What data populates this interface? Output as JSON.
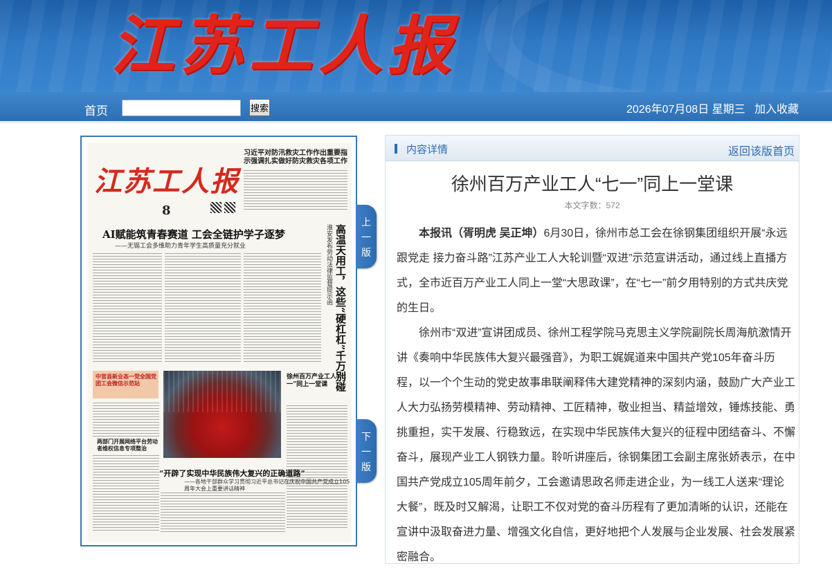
{
  "header": {
    "masthead": "江苏工人报",
    "nav_home": "首页",
    "search_placeholder": "",
    "search_label": "搜索",
    "date": "2026年07月08日 星期三",
    "favorite": "加入收藏"
  },
  "paper_page": {
    "masthead": "江苏工人报",
    "page_no": "8",
    "top_headline": "习近平对防汛救灾工作作出重要指示强调扎实做好防灾救灾各项工作",
    "headline1": "AI赋能筑青春赛道 工会全链护学子逐梦",
    "subheadline1": "——无锡工会多维助力青年学生高质量充分就业",
    "vertical_headline": "高温天用工，这些“硬杠杠”千万别碰",
    "vertical_sub": "淮安发布劳动法律监督提示函",
    "side_headline": "中官县新业态一党全国党团工会微信示范站",
    "side_headline2": "两部门开展网络平台劳动者维权信息专项整治",
    "mid_headline": "徐州百万产业工人“七一”同上一堂课",
    "headline2": "“开辟了实现中华民族伟大复兴的正确道路”",
    "subheadline2": "——各地干部群众学习贯彻习近平总书记在庆祝中国共产党成立105周年大会上重要讲话精神"
  },
  "page_nav": {
    "prev": [
      "上",
      "一",
      "版"
    ],
    "next": [
      "下",
      "一",
      "版"
    ]
  },
  "article": {
    "section_label": "内容详情",
    "back_link": "返回该版首页",
    "title": "徐州百万产业工人“七一”同上一堂课",
    "word_count": "本文字数：572",
    "lead": "本报讯（胥明虎 吴正坤）",
    "para1": "6月30日，徐州市总工会在徐钢集团组织开展“永远跟党走 接力奋斗路”江苏产业工人大轮训暨“双进”示范宣讲活动，通过线上直播方式，全市近百万产业工人同上一堂“大思政课”，在“七一”前夕用特别的方式共庆党的生日。",
    "para2": "徐州市“双进”宣讲团成员、徐州工程学院马克思主义学院副院长周海航激情开讲《奏响中华民族伟大复兴最强音》，为职工娓娓道来中国共产党105年奋斗历程，以一个个生动的党史故事串联阐释伟大建党精神的深刻内涵，鼓励广大产业工人大力弘扬劳模精神、劳动精神、工匠精神，敬业担当、精益增效，锤炼技能、勇挑重担，实干发展、行稳致远，在实现中华民族伟大复兴的征程中团结奋斗、不懈奋斗，展现产业工人钢铁力量。聆听讲座后，徐钢集团工会副主席张娇表示，在中国共产党成立105周年前夕，工会邀请思政名师走进企业，为一线工人送来“理论大餐”，既及时又解渴，让职工不仅对党的奋斗历程有了更加清晰的认识，还能在宣讲中汲取奋进力量、增强文化自信，更好地把个人发展与企业发展、社会发展紧密融合。"
  }
}
